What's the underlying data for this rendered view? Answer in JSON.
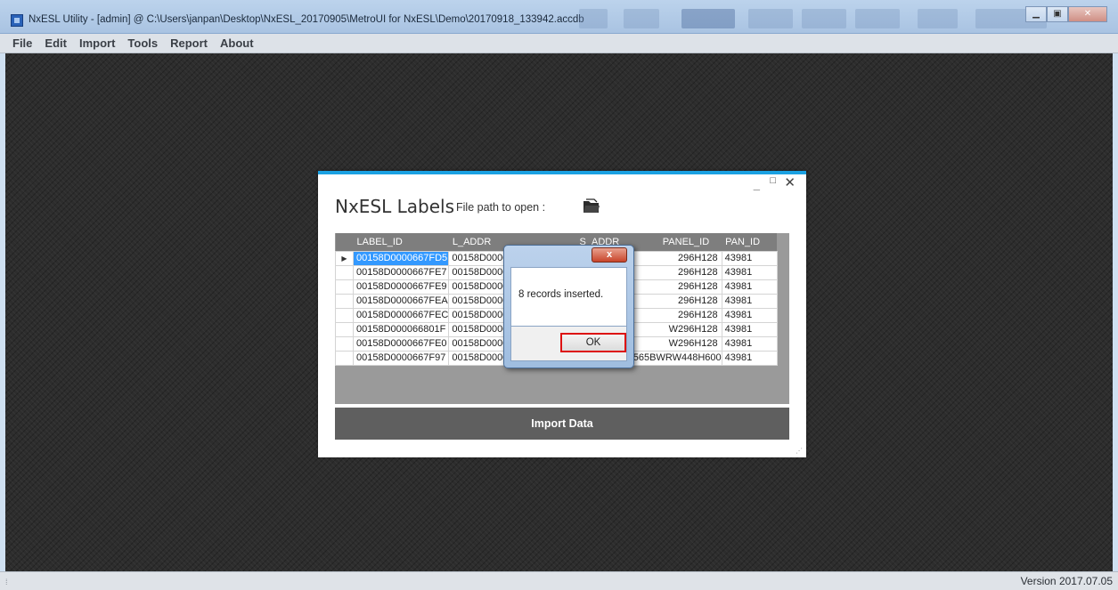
{
  "window": {
    "title": "NxESL Utility - [admin] @ C:\\Users\\janpan\\Desktop\\NxESL_20170905\\MetroUI for NxESL\\Demo\\20170918_133942.accdb"
  },
  "menu": [
    "File",
    "Edit",
    "Import",
    "Tools",
    "Report",
    "About"
  ],
  "status": {
    "version": "Version 2017.07.05"
  },
  "labels_form": {
    "title": "NxESL Labels",
    "path_label": "File path to open :",
    "import_button": "Import Data",
    "columns": [
      "LABEL_ID",
      "L_ADDR",
      "S_ADDR",
      "PANEL_ID",
      "PAN_ID"
    ],
    "rows": [
      [
        "00158D0000667FD5",
        "00158D000066",
        "",
        "296H128",
        "43981"
      ],
      [
        "00158D0000667FE7",
        "00158D000066",
        "",
        "296H128",
        "43981"
      ],
      [
        "00158D0000667FE9",
        "00158D000066",
        "",
        "296H128",
        "43981"
      ],
      [
        "00158D0000667FEA",
        "00158D000066",
        "",
        "296H128",
        "43981"
      ],
      [
        "00158D0000667FEC",
        "00158D000066",
        "",
        "296H128",
        "43981"
      ],
      [
        "00158D000066801F",
        "00158D000066",
        "",
        "W296H128",
        "43981"
      ],
      [
        "00158D0000667FE0",
        "00158D000066",
        "",
        "W296H128",
        "43981"
      ],
      [
        "00158D0000667F97",
        "00158D0000667F97",
        "",
        "0565BWRW448H600",
        "43981"
      ]
    ]
  },
  "message_box": {
    "close_glyph": "x",
    "text": "8 records inserted.",
    "ok_label": "OK"
  },
  "colors": {
    "accent": "#1ba1e2",
    "selection": "#3399ff",
    "highlight_border": "#dd1111"
  }
}
